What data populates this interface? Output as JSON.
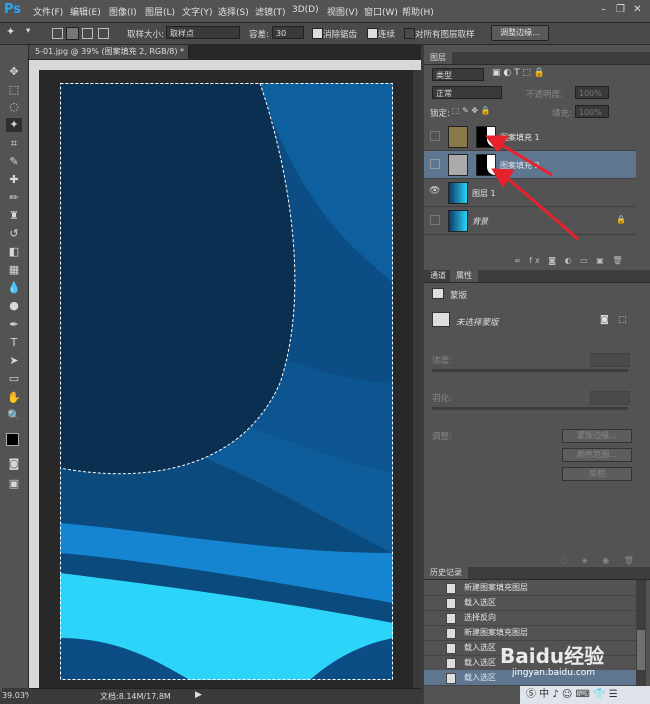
{
  "app": {
    "logo": "Ps"
  },
  "menu": [
    "文件(F)",
    "编辑(E)",
    "图像(I)",
    "图层(L)",
    "文字(Y)",
    "选择(S)",
    "滤镜(T)",
    "3D(D)",
    "视图(V)",
    "窗口(W)",
    "帮助(H)"
  ],
  "options": {
    "sample_size_label": "取样大小:",
    "sample_size_value": "取样点",
    "tolerance_label": "容差:",
    "tolerance_value": "30",
    "antialias_label": "消除锯齿",
    "contiguous_label": "连续",
    "sample_all_label": "对所有图层取样",
    "refine_edge_label": "调整边缘..."
  },
  "document": {
    "tab_title": "5-01.jpg @ 39% (图案填充 2, RGB/8) *",
    "zoom": "39.03%",
    "doc_info": "文档:8.14M/17.8M"
  },
  "layers_panel": {
    "tab": "图层",
    "filter_kind": "类型",
    "blend_mode": "正常",
    "opacity_label": "不透明度:",
    "opacity_value": "100%",
    "lock_label": "锁定:",
    "fill_label": "填充:",
    "fill_value": "100%",
    "layers": [
      {
        "name": "图案填充 1",
        "visible": false,
        "selected": false
      },
      {
        "name": "图案填充 2",
        "visible": false,
        "selected": true
      },
      {
        "name": "图层 1",
        "visible": true,
        "selected": false
      },
      {
        "name": "背景",
        "visible": false,
        "selected": false,
        "locked": true
      }
    ]
  },
  "properties_panel": {
    "tabs": [
      "通道",
      "属性"
    ],
    "active_tab": "属性",
    "section": "蒙版",
    "mask_status": "未选择蒙版",
    "density_label": "浓度:",
    "feather_label": "羽化:",
    "adjust_label": "调整:",
    "mask_edge_button": "蒙版边缘...",
    "color_range_button": "颜色范围...",
    "invert_button": "反相"
  },
  "history_panel": {
    "tab": "历史记录",
    "items": [
      "新建图案填充图层",
      "载入选区",
      "选择反向",
      "新建图案填充图层",
      "载入选区",
      "载入选区",
      "载入选区"
    ]
  },
  "watermark": {
    "text": "Baidu经验",
    "url": "jingyan.baidu.com"
  },
  "colors": {
    "accent": "#2fa3f2",
    "arrow": "#e8222c",
    "selected_row": "#5f7691"
  }
}
